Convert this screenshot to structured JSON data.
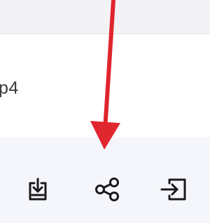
{
  "file": {
    "name_fragment": "p4"
  },
  "actions": [
    {
      "id": "download",
      "icon": "download-icon"
    },
    {
      "id": "share",
      "icon": "share-icon"
    },
    {
      "id": "import",
      "icon": "import-icon"
    }
  ],
  "annotation": {
    "icon": "red-arrow-icon",
    "color": "#e0262e",
    "points_to": "share"
  },
  "colors": {
    "action_bar_bg": "#f5f6fb",
    "icon_stroke": "#1a1a1a"
  }
}
